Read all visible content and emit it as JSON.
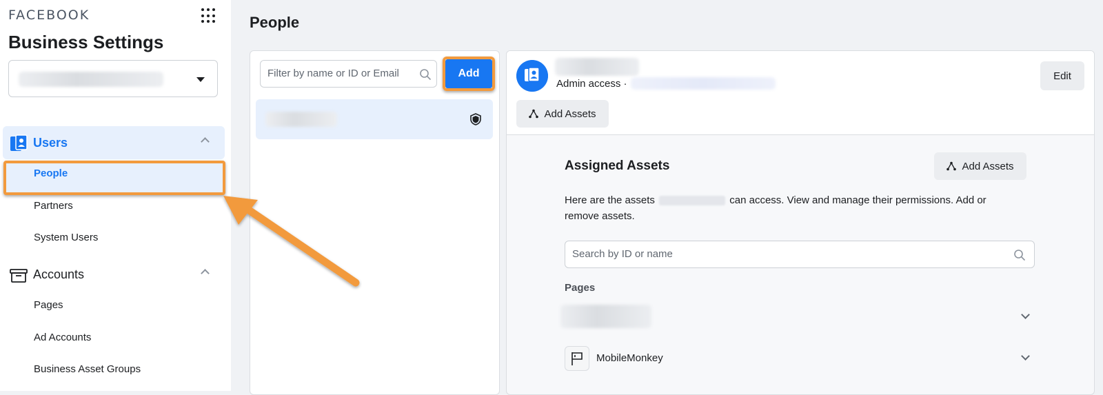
{
  "sidebar": {
    "brand": "FACEBOOK",
    "title": "Business Settings",
    "groups": [
      {
        "label": "Users",
        "icon": "users-icon",
        "active": true
      },
      {
        "label": "Accounts",
        "icon": "archive-box-icon",
        "active": false
      }
    ],
    "users_items": [
      "People",
      "Partners",
      "System Users"
    ],
    "accounts_items": [
      "Pages",
      "Ad Accounts",
      "Business Asset Groups"
    ]
  },
  "main": {
    "title": "People",
    "filter_placeholder": "Filter by name or ID or Email",
    "add_label": "Add"
  },
  "detail": {
    "access_label": "Admin access ·",
    "edit_label": "Edit",
    "add_assets_label": "Add Assets",
    "assigned_title": "Assigned Assets",
    "assigned_add_label": "Add Assets",
    "desc_before": "Here are the assets",
    "desc_after": "can access. View and manage their permissions. Add or remove assets.",
    "search_placeholder": "Search by ID or name",
    "pages_label": "Pages",
    "page_items": [
      {
        "name": "",
        "redacted": true
      },
      {
        "name": "MobileMonkey",
        "icon": "flag-icon",
        "redacted": false
      }
    ]
  },
  "colors": {
    "accent": "#1877f2",
    "highlight": "#f29a3d",
    "active_bg": "#e7f0fd"
  }
}
